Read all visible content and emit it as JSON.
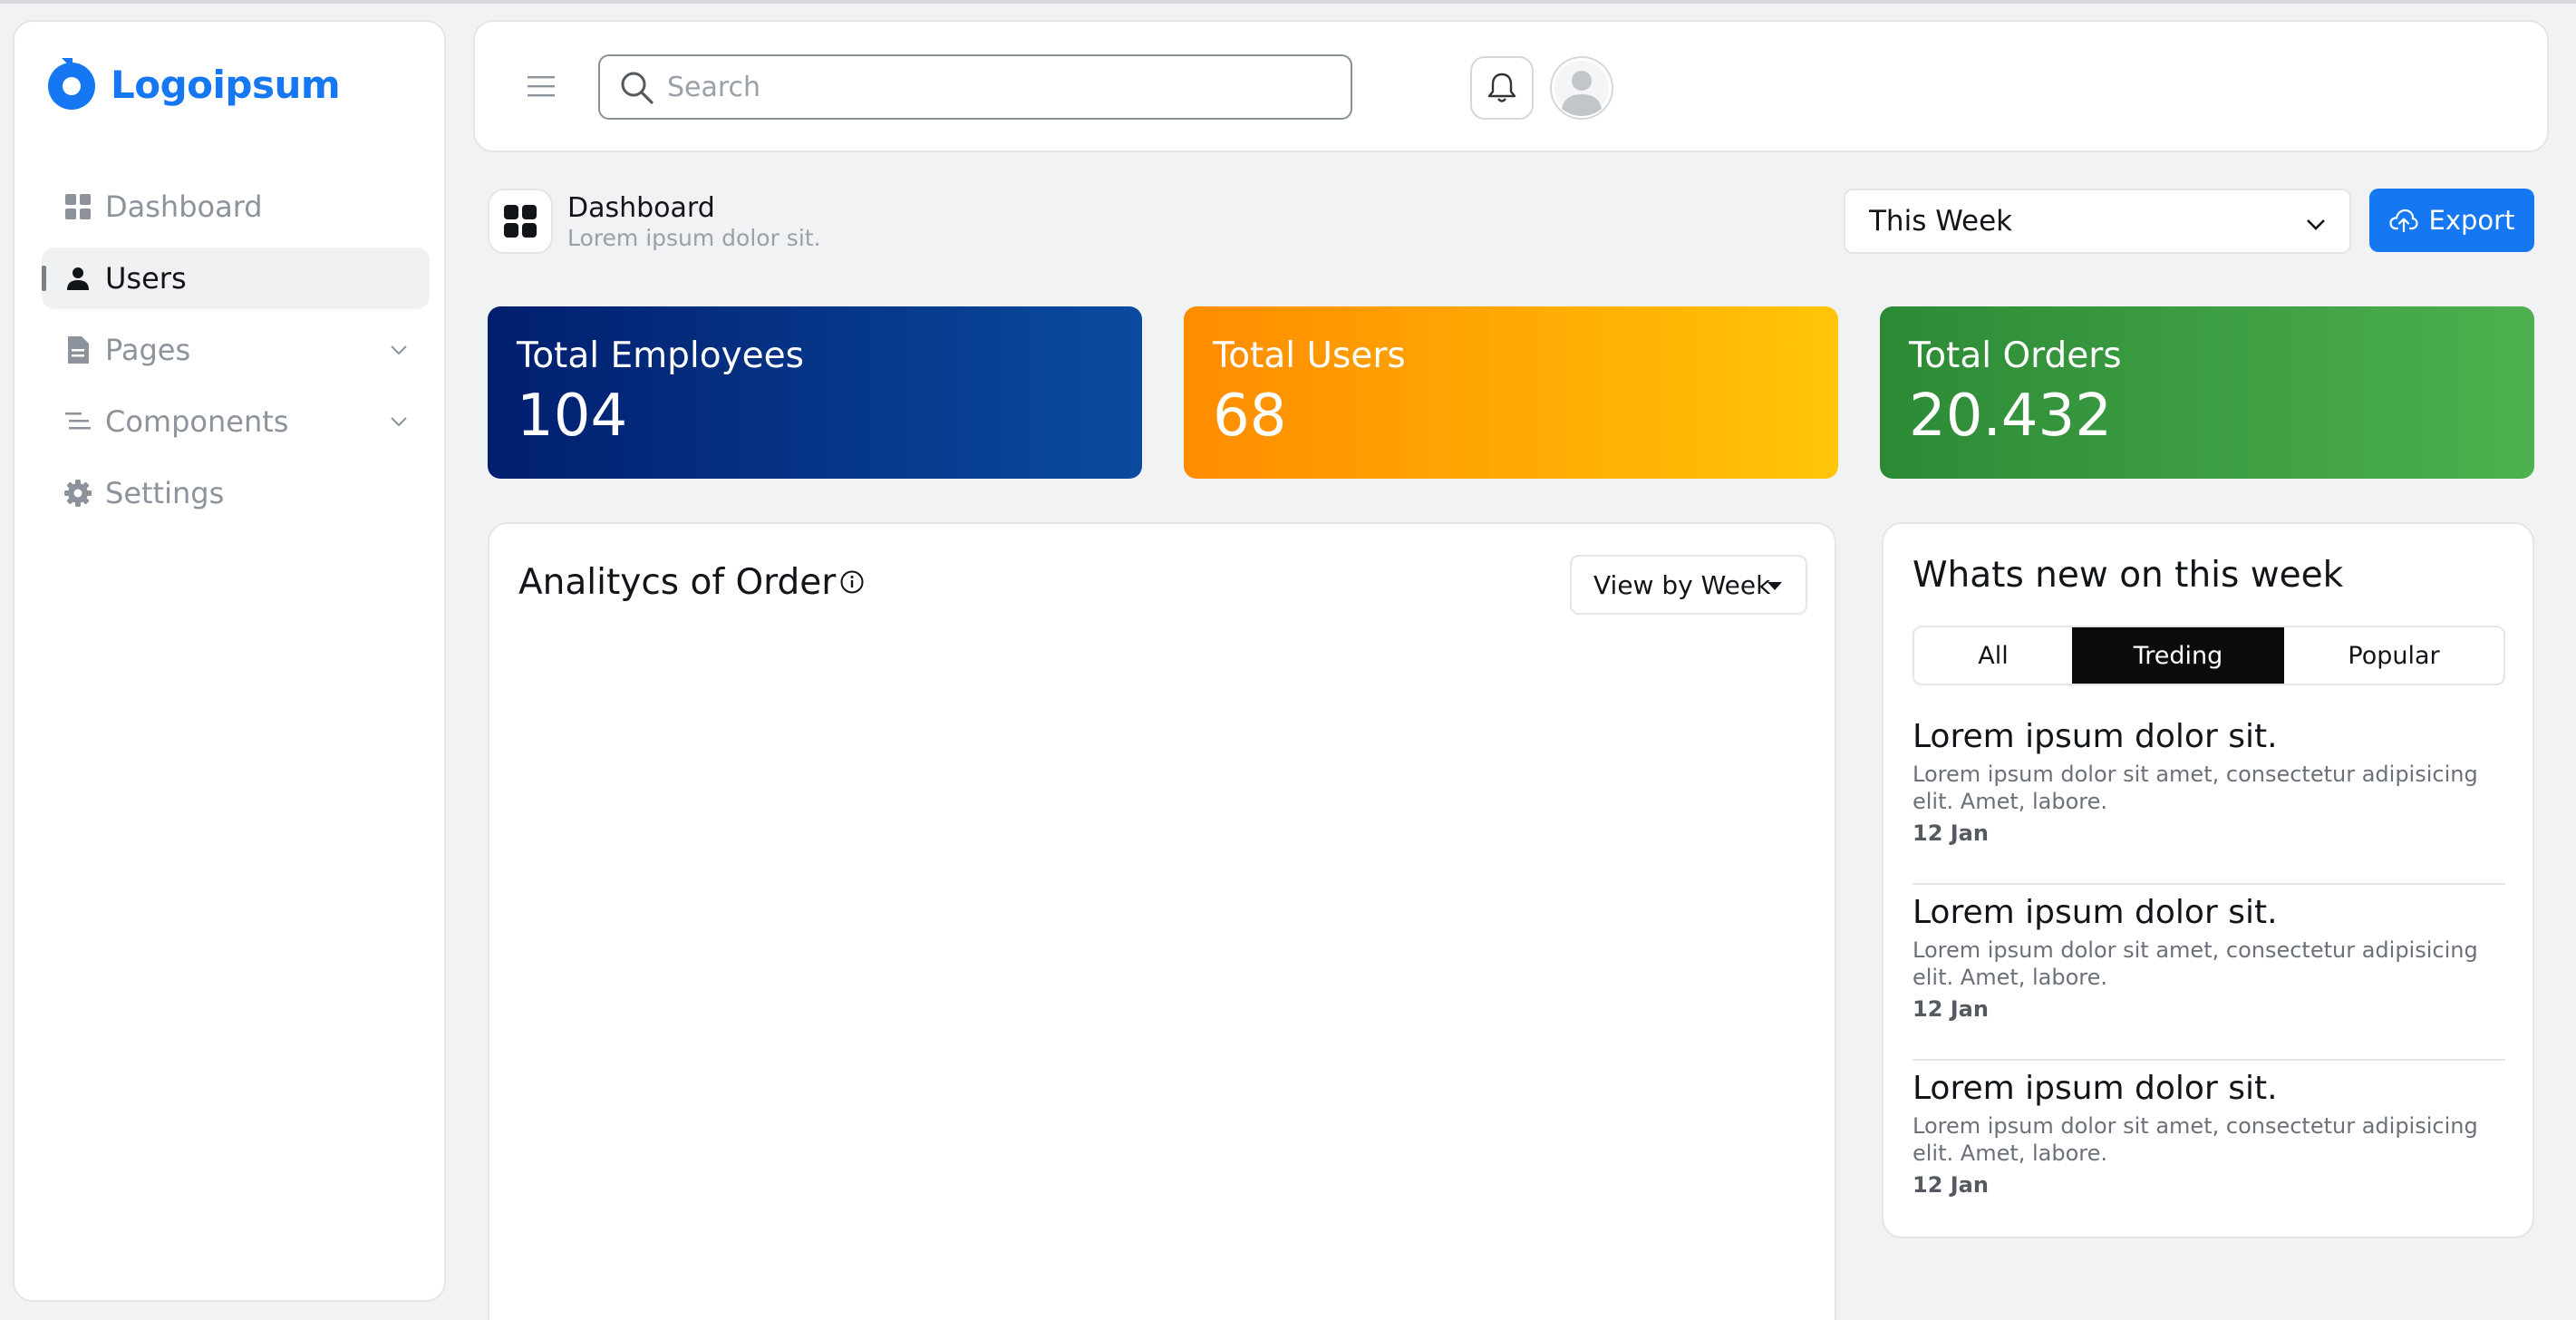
{
  "brand": {
    "name": "Logoipsum",
    "color": "#1677f2"
  },
  "sidebar": {
    "items": [
      {
        "label": "Dashboard",
        "icon": "dashboard-grid-icon",
        "active": false
      },
      {
        "label": "Users",
        "icon": "user-icon",
        "active": true
      },
      {
        "label": "Pages",
        "icon": "document-icon",
        "active": false,
        "expandable": true
      },
      {
        "label": "Components",
        "icon": "list-icon",
        "active": false,
        "expandable": true
      },
      {
        "label": "Settings",
        "icon": "gear-icon",
        "active": false
      }
    ]
  },
  "header": {
    "search_placeholder": "Search",
    "icons": [
      "menu-icon",
      "search-icon",
      "bell-icon",
      "avatar-icon"
    ]
  },
  "page": {
    "title": "Dashboard",
    "subtitle": "Lorem ipsum dolor sit.",
    "period_select": "This Week",
    "export_label": "Export"
  },
  "stats": [
    {
      "label": "Total Employees",
      "value": "104",
      "colors": [
        "#011e6e",
        "#0a4b9f"
      ]
    },
    {
      "label": "Total Users",
      "value": "68",
      "colors": [
        "#ff8c00",
        "#ffc507"
      ]
    },
    {
      "label": "Total Orders",
      "value": "20.432",
      "colors": [
        "#2c8a35",
        "#4db14f"
      ]
    }
  ],
  "analytics": {
    "title": "Analitycs of Order",
    "view_label": "View by Week"
  },
  "news": {
    "title": "Whats new on this week",
    "tabs": [
      {
        "label": "All",
        "active": false
      },
      {
        "label": "Treding",
        "active": true
      },
      {
        "label": "Popular",
        "active": false
      }
    ],
    "items": [
      {
        "title": "Lorem ipsum dolor sit.",
        "desc": "Lorem ipsum dolor sit amet, consectetur adipisicing elit. Amet, labore.",
        "date": "12 Jan"
      },
      {
        "title": "Lorem ipsum dolor sit.",
        "desc": "Lorem ipsum dolor sit amet, consectetur adipisicing elit. Amet, labore.",
        "date": "12 Jan"
      },
      {
        "title": "Lorem ipsum dolor sit.",
        "desc": "Lorem ipsum dolor sit amet, consectetur adipisicing elit. Amet, labore.",
        "date": "12 Jan"
      }
    ]
  }
}
